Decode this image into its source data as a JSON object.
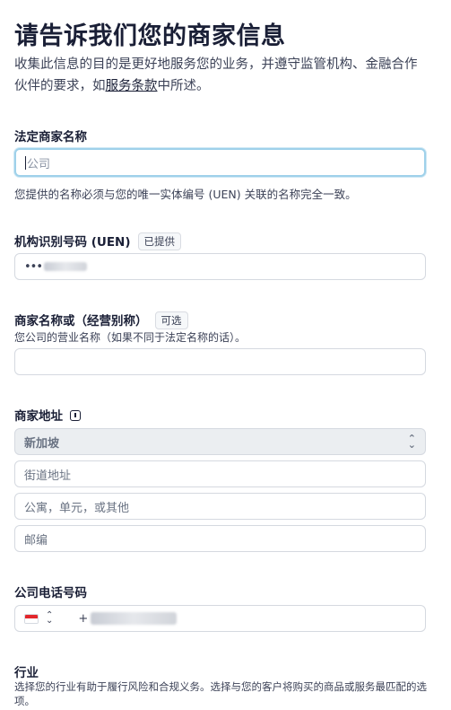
{
  "header": {
    "title": "请告诉我们您的商家信息",
    "subtitle_prefix": "收集此信息的目的是更好地服务您的业务，并遵守监管机构、金融合作伙伴的要求，如",
    "subtitle_link": "服务条款",
    "subtitle_suffix": "中所述。"
  },
  "legal_name": {
    "label": "法定商家名称",
    "placeholder": "公司",
    "help": "您提供的名称必须与您的唯一实体编号 (UEN) 关联的名称完全一致。"
  },
  "uen": {
    "label": "机构识别号码 (UEN)",
    "badge": "已提供",
    "value_masked": "•••"
  },
  "dba": {
    "label": "商家名称或（经营别称）",
    "badge": "可选",
    "hint": "您公司的营业名称（如果不同于法定名称的话）。",
    "placeholder": ""
  },
  "address": {
    "label": "商家地址",
    "country": "新加坡",
    "street_placeholder": "街道地址",
    "unit_placeholder": "公寓，单元，或其他",
    "postal_placeholder": "邮编"
  },
  "phone": {
    "label": "公司电话号码",
    "country_flag": "flag-singapore-icon",
    "value_masked": "+"
  },
  "industry": {
    "label": "行业",
    "help": "选择您的行业有助于履行风险和合规义务。选择与您的客户将购买的商品或服务最匹配的选项。"
  },
  "colors": {
    "text": "#1a1f36",
    "focus_ring": "#9fd1ea",
    "select_bg": "#ebeef1"
  }
}
